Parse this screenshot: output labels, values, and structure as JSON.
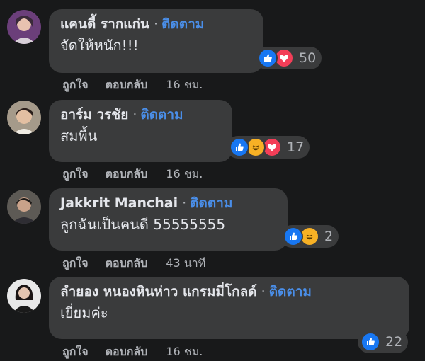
{
  "comments": [
    {
      "name": "แคนดี้ รากแก่น",
      "separator": "·",
      "follow": "ติดตาม",
      "text": "จัดให้หนัก!!!",
      "reactions": [
        "like-icon",
        "love-icon"
      ],
      "reaction_count": "50",
      "like": "ถูกใจ",
      "reply": "ตอบกลับ",
      "time": "16 ชม."
    },
    {
      "name": "อาร์ม วรชัย",
      "separator": "·",
      "follow": "ติดตาม",
      "text": "สมพื้น",
      "reactions": [
        "like-icon",
        "haha-icon",
        "love-icon"
      ],
      "reaction_count": "17",
      "like": "ถูกใจ",
      "reply": "ตอบกลับ",
      "time": "16 ชม."
    },
    {
      "name": "Jakkrit Manchai",
      "separator": "·",
      "follow": "ติดตาม",
      "text": "ลูกฉันเป็นคนดี 55555555",
      "reactions": [
        "like-icon",
        "haha-icon"
      ],
      "reaction_count": "2",
      "like": "ถูกใจ",
      "reply": "ตอบกลับ",
      "time": "43 นาที"
    },
    {
      "name": "ลำยอง หนองหินห่าว แกรมมี่โกลด์",
      "separator": "·",
      "follow": "ติดตาม",
      "text": "เยี่ยมค่ะ",
      "reactions": [
        "like-icon"
      ],
      "reaction_count": "22",
      "like": "ถูกใจ",
      "reply": "ตอบกลับ",
      "time": "16 ชม."
    }
  ],
  "colors": {
    "background": "#18191a",
    "bubble": "#3a3b3c",
    "follow_link": "#4a8ee8",
    "like_blue": "#1877f2",
    "love_red": "#f33e58",
    "haha_yellow": "#f7b125"
  }
}
